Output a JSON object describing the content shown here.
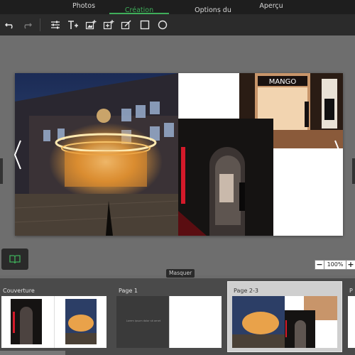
{
  "tabs": [
    {
      "label": "Photos",
      "active": false
    },
    {
      "label": "Création\nBeau-Livre",
      "active": true
    },
    {
      "label": "Options du\nBeau-Livre",
      "active": false
    },
    {
      "label": "Aperçu",
      "active": false
    }
  ],
  "toolbar": {
    "tools": [
      "undo-icon",
      "redo-icon",
      "adjust-icon",
      "add-text-icon",
      "add-image-icon",
      "add-frame-icon",
      "edit-frame-icon",
      "rectangle-icon",
      "circle-icon"
    ]
  },
  "canvas": {
    "zoom": "100%",
    "zoom_minus": "−",
    "zoom_plus": "+"
  },
  "panel": {
    "hide_label": "Masquer",
    "pages": [
      {
        "label": "Couverture"
      },
      {
        "label": "Page 1",
        "caption": "Lorem ipsum dolor sit amet"
      },
      {
        "label": "Page 2-3",
        "selected": true
      },
      {
        "label": "P"
      }
    ]
  },
  "colors": {
    "accent": "#3fae5a",
    "topbar": "#1e1e1e",
    "toolbar": "#2b2b2b",
    "workspace": "#6e6e6e"
  }
}
